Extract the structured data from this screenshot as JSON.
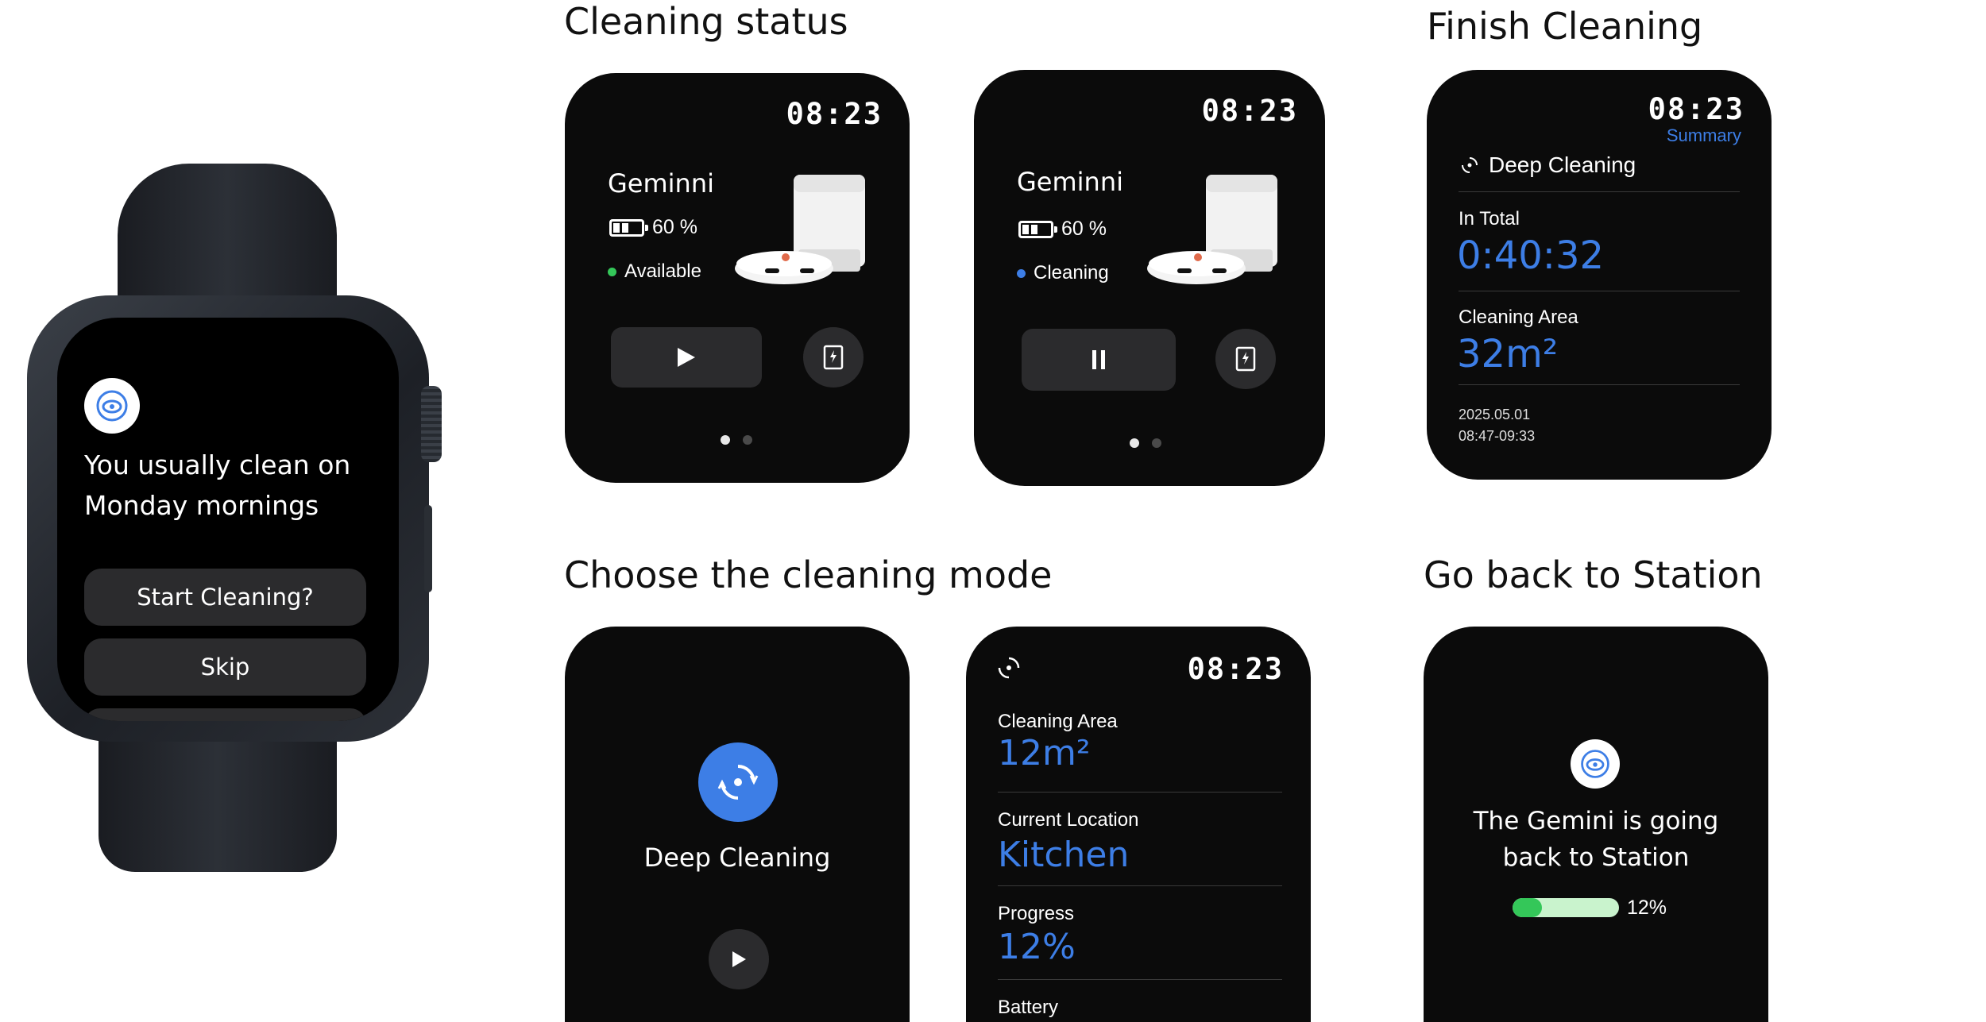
{
  "headings": {
    "cleaning_status": "Cleaning status",
    "finish_cleaning": "Finish Cleaning",
    "choose_mode": "Choose the cleaning mode",
    "go_back": "Go back to Station"
  },
  "watch": {
    "notification_line1": "You usually clean on",
    "notification_line2": "Monday mornings",
    "start_button": "Start Cleaning?",
    "skip_button": "Skip"
  },
  "status_available": {
    "time": "08:23",
    "device_name": "Geminni",
    "battery": "60 %",
    "status": "Available",
    "status_color": "#34c759"
  },
  "status_cleaning": {
    "time": "08:23",
    "device_name": "Geminni",
    "battery": "60 %",
    "status": "Cleaning",
    "status_color": "#3d7ee6"
  },
  "summary": {
    "time": "08:23",
    "subtitle": "Summary",
    "mode": "Deep Cleaning",
    "total_label": "In Total",
    "total_value": "0:40:32",
    "area_label": "Cleaning Area",
    "area_value": "32m²",
    "date": "2025.05.01",
    "time_range": "08:47-09:33"
  },
  "mode_select": {
    "mode_label": "Deep Cleaning"
  },
  "progress_detail": {
    "time": "08:23",
    "area_label": "Cleaning Area",
    "area_value": "12m²",
    "location_label": "Current Location",
    "location_value": "Kitchen",
    "progress_label": "Progress",
    "progress_value": "12%",
    "battery_label": "Battery"
  },
  "return_station": {
    "line1": "The Gemini is going",
    "line2": "back to Station",
    "progress_text": "12%",
    "progress_fraction": 0.12
  },
  "colors": {
    "accent_blue": "#3d7ee6",
    "success_green": "#34c759",
    "panel_bg": "#0b0b0b"
  }
}
